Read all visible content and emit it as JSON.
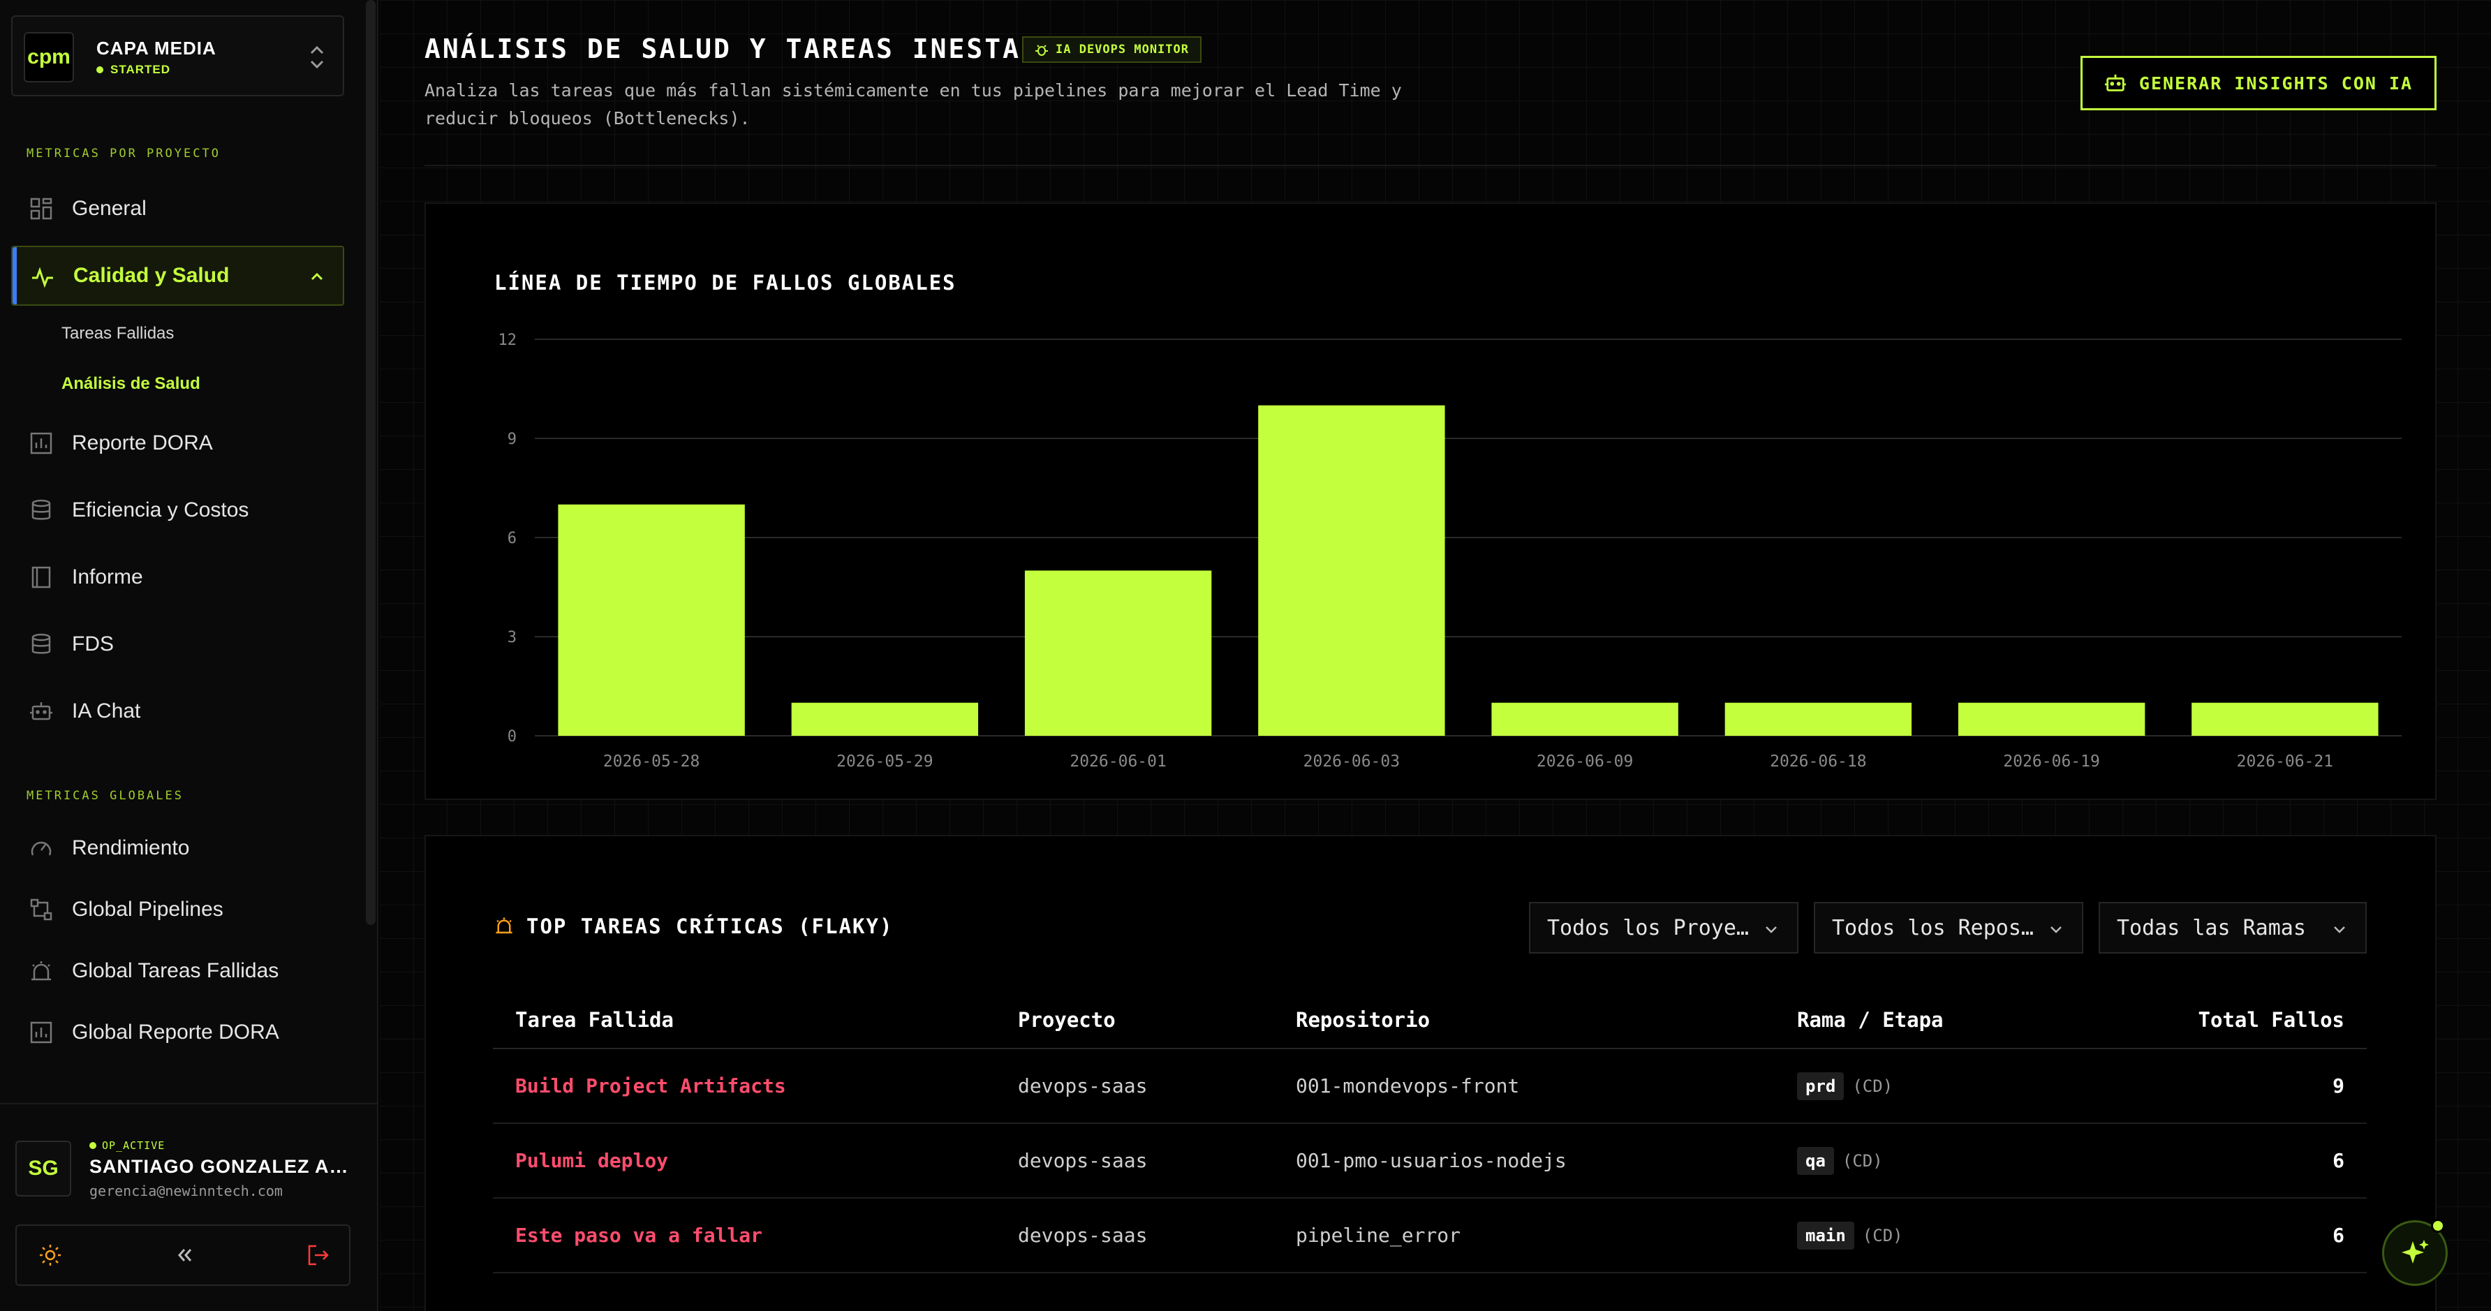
{
  "project": {
    "logo": "cpm",
    "name": "CAPA MEDIA",
    "status": "STARTED"
  },
  "sidebar": {
    "section_project": "METRICAS POR PROYECTO",
    "section_global": "METRICAS GLOBALES",
    "items": [
      {
        "label": "General",
        "icon": "grid-icon"
      },
      {
        "label": "Calidad y Salud",
        "icon": "activity-icon"
      },
      {
        "label": "Reporte DORA",
        "icon": "bar-chart-icon"
      },
      {
        "label": "Eficiencia y Costos",
        "icon": "database-icon"
      },
      {
        "label": "Informe",
        "icon": "book-icon"
      },
      {
        "label": "FDS",
        "icon": "database-icon"
      },
      {
        "label": "IA Chat",
        "icon": "bot-icon"
      }
    ],
    "subitems": [
      {
        "label": "Tareas Fallidas"
      },
      {
        "label": "Análisis de Salud"
      }
    ],
    "global_items": [
      {
        "label": "Rendimiento",
        "icon": "gauge-icon"
      },
      {
        "label": "Global Pipelines",
        "icon": "workflow-icon"
      },
      {
        "label": "Global Tareas Fallidas",
        "icon": "alarm-icon"
      },
      {
        "label": "Global Reporte DORA",
        "icon": "bar-chart-icon"
      }
    ]
  },
  "user": {
    "initials": "SG",
    "status": "OP_ACTIVE",
    "name": "SANTIAGO GONZALEZ ACEVEDO",
    "email": "gerencia@newinntech.com"
  },
  "header": {
    "title": "ANÁLISIS DE SALUD Y TAREAS INESTABLES",
    "badge": "IA DEVOPS MONITOR",
    "description": "Analiza las tareas que más fallan sistémicamente en tus pipelines para mejorar el Lead Time y reducir bloqueos (Bottlenecks).",
    "insights_button": "GENERAR INSIGHTS CON IA"
  },
  "timeline": {
    "title": "LÍNEA DE TIEMPO DE FALLOS GLOBALES"
  },
  "chart_data": {
    "type": "bar",
    "title": "LÍNEA DE TIEMPO DE FALLOS GLOBALES",
    "categories": [
      "2026-05-28",
      "2026-05-29",
      "2026-06-01",
      "2026-06-03",
      "2026-06-09",
      "2026-06-18",
      "2026-06-19",
      "2026-06-21"
    ],
    "values": [
      7,
      1,
      5,
      10,
      1,
      1,
      1,
      1
    ],
    "yticks": [
      0,
      3,
      6,
      9,
      12
    ],
    "ylim": [
      0,
      12
    ],
    "grid": true,
    "bar_color": "#c4ff3d"
  },
  "tasks_section": {
    "title": "TOP TAREAS CRÍTICAS (FLAKY)",
    "filters": [
      "Todos los Proye…",
      "Todos los Repos…",
      "Todas las Ramas"
    ],
    "columns": [
      "Tarea Fallida",
      "Proyecto",
      "Repositorio",
      "Rama / Etapa",
      "Total Fallos"
    ],
    "rows": [
      {
        "task": "Build Project Artifacts",
        "project": "devops-saas",
        "repo": "001-mondevops-front",
        "branch": "prd",
        "stage": "(CD)",
        "failures": "9"
      },
      {
        "task": "Pulumi deploy",
        "project": "devops-saas",
        "repo": "001-pmo-usuarios-nodejs",
        "branch": "qa",
        "stage": "(CD)",
        "failures": "6"
      },
      {
        "task": "Este paso va a fallar",
        "project": "devops-saas",
        "repo": "pipeline_error",
        "branch": "main",
        "stage": "(CD)",
        "failures": "6"
      }
    ]
  },
  "colors": {
    "accent": "#c4ff3d",
    "danger": "#ff4d6d",
    "active_bar": "#3d7bff"
  }
}
